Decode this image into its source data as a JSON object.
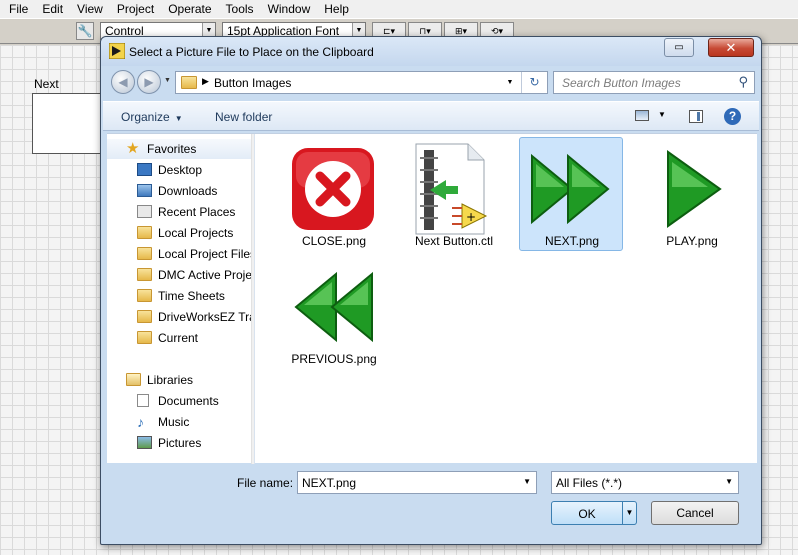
{
  "menu": [
    "File",
    "Edit",
    "View",
    "Project",
    "Operate",
    "Tools",
    "Window",
    "Help"
  ],
  "toolbar": {
    "control_combo": "Control",
    "font_combo": "15pt Application Font"
  },
  "front_panel": {
    "label": "Next"
  },
  "dialog": {
    "title": "Select a Picture File to Place on the Clipboard",
    "restore_glyph": "▭",
    "close_glyph": "✕",
    "address_path": "Button Images",
    "search_placeholder": "Search Button Images",
    "organize_label": "Organize",
    "new_folder_label": "New folder",
    "help_glyph": "?",
    "favorites_label": "Favorites",
    "favorites": [
      "Desktop",
      "Downloads",
      "Recent Places",
      "Local Projects",
      "Local Project Files",
      "DMC Active Projects",
      "Time Sheets",
      "DriveWorksEZ Training",
      "Current"
    ],
    "libraries_label": "Libraries",
    "libraries": [
      "Documents",
      "Music",
      "Pictures"
    ],
    "files": [
      {
        "name": "CLOSE.png",
        "icon": "close-red-icon"
      },
      {
        "name": "Next Button.ctl",
        "icon": "labview-control-icon"
      },
      {
        "name": "NEXT.png",
        "icon": "fast-forward-green-icon",
        "selected": true
      },
      {
        "name": "PLAY.png",
        "icon": "play-green-icon"
      },
      {
        "name": "PREVIOUS.png",
        "icon": "rewind-green-icon"
      }
    ],
    "file_name_label": "File name:",
    "file_name_value": "NEXT.png",
    "file_type_value": "All Files (*.*)",
    "ok_label": "OK",
    "cancel_label": "Cancel"
  }
}
